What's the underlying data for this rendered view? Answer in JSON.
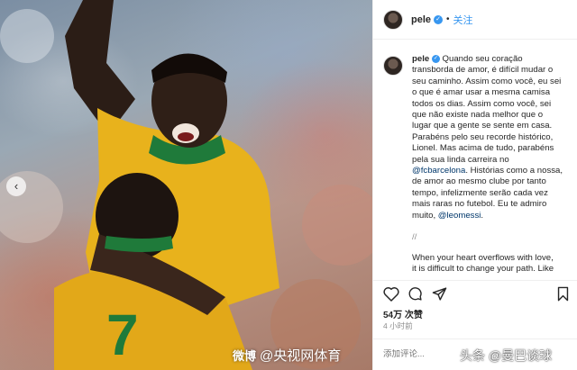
{
  "photo": {
    "jersey_number": "7",
    "watermark": {
      "logo_text": "微博",
      "text": "@央视网体育"
    },
    "nav_prev_icon": "chevron-left-icon"
  },
  "header": {
    "username": "pele",
    "verified_icon": "verified-badge-icon",
    "separator": "•",
    "follow_label": "关注"
  },
  "caption": {
    "username": "pele",
    "lines": [
      "Quando seu coração",
      "transborda de amor, é difícil mudar o",
      "seu caminho. Assim como você, eu sei",
      "o que é amar usar a mesma camisa",
      "todos os dias. Assim como você, sei",
      "que não existe nada melhor que o",
      "lugar que a gente se sente em casa.",
      "Parabéns pelo seu recorde histórico,",
      "Lionel. Mas acima de tudo, parabéns",
      "pela sua linda carreira no"
    ],
    "mention_fcb": "@fcbarcelona",
    "after_fcb": ". Histórias como a nossa,",
    "lines2": [
      "de amor ao mesmo clube por tanto",
      "tempo, infelizmente serão cada vez",
      "mais raras no futebol. Eu te admiro"
    ],
    "before_messi": "muito, ",
    "mention_messi": "@leomessi",
    "after_messi": ".",
    "separator": "//",
    "english": [
      "When your heart overflows with love,",
      "it is difficult to change your path. Like"
    ]
  },
  "actions": {
    "like_icon": "heart-icon",
    "comment_icon": "comment-icon",
    "share_icon": "share-icon",
    "save_icon": "bookmark-icon",
    "likes": "54万 次赞",
    "time": "4 小时前",
    "comment_placeholder": "添加评论..."
  },
  "overlay": {
    "toutiao_watermark": "头条 @曼巴谈球"
  }
}
